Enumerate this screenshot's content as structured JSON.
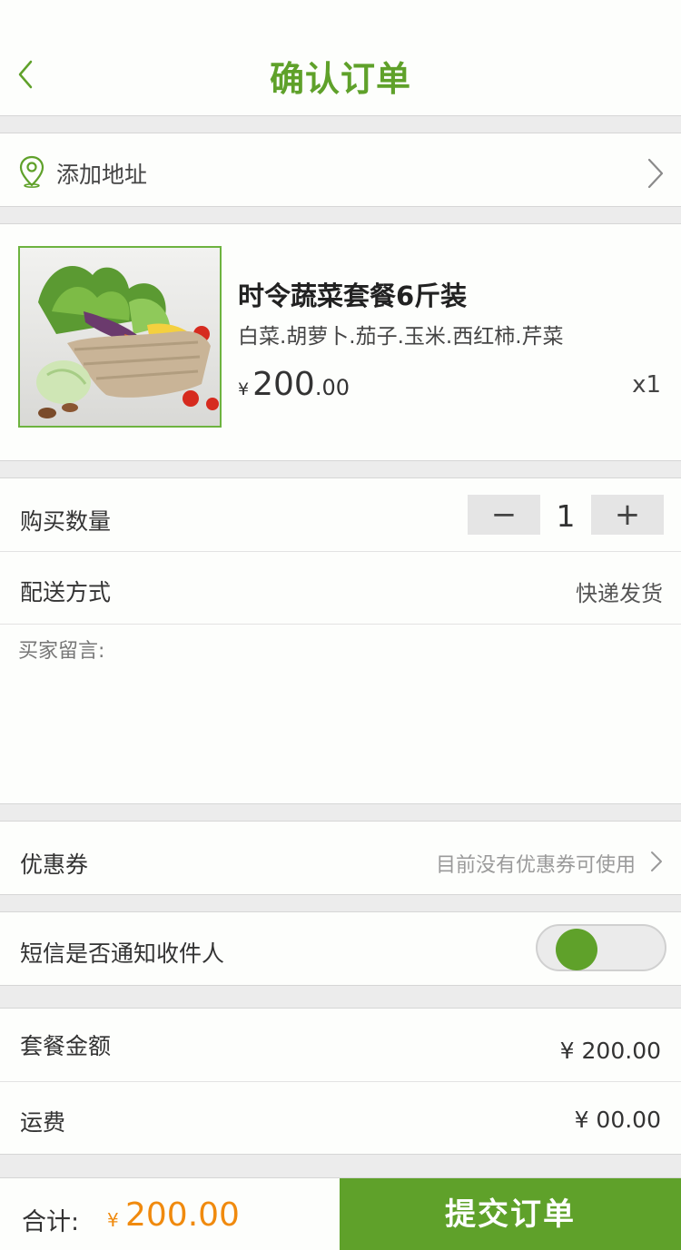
{
  "header": {
    "title": "确认订单",
    "back_icon": "chevron-left-icon"
  },
  "address": {
    "label": "添加地址",
    "icon": "location-pin-icon",
    "arrow_icon": "chevron-right-icon"
  },
  "product": {
    "name": "时令蔬菜套餐6斤装",
    "description": "白菜.胡萝卜.茄子.玉米.西红柿.芹菜",
    "currency": "¥",
    "price_int": "200",
    "price_dec": ".00",
    "quantity": "x1"
  },
  "details": {
    "quantity_label": "购买数量",
    "quantity_value": "1",
    "minus_label": "−",
    "plus_label": "+",
    "delivery_label": "配送方式",
    "delivery_value": "快递发货",
    "message_placeholder": "买家留言:"
  },
  "coupon": {
    "label": "优惠券",
    "value": "目前没有优惠券可使用"
  },
  "sms": {
    "label": "短信是否通知收件人",
    "enabled": true
  },
  "amounts": {
    "package_label": "套餐金额",
    "package_value": "¥ 200.00",
    "shipping_label": "运费",
    "shipping_value": "¥ 00.00"
  },
  "footer": {
    "total_label": "合计:",
    "total_currency": "¥",
    "total_value": "200.00",
    "submit_label": "提交订单"
  },
  "colors": {
    "brand": "#5fa12a",
    "price": "#f08a0e",
    "background": "#ececec"
  }
}
